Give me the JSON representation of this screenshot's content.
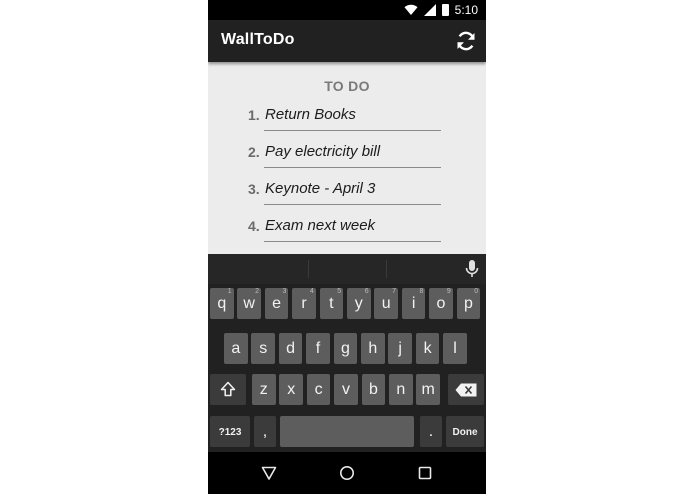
{
  "status_bar": {
    "time": "5:10",
    "icons": [
      "wifi-icon",
      "signal-icon",
      "battery-icon"
    ]
  },
  "app_bar": {
    "title": "WallToDo",
    "action_icon": "refresh-icon"
  },
  "todo": {
    "heading": "TO DO",
    "items": [
      {
        "number": "1.",
        "text": "Return Books"
      },
      {
        "number": "2.",
        "text": "Pay electricity bill"
      },
      {
        "number": "3.",
        "text": "Keynote - April 3"
      },
      {
        "number": "4.",
        "text": "Exam next week"
      }
    ]
  },
  "keyboard": {
    "mic_icon": "microphone-icon",
    "row1": [
      {
        "label": "q",
        "hint": "1"
      },
      {
        "label": "w",
        "hint": "2"
      },
      {
        "label": "e",
        "hint": "3"
      },
      {
        "label": "r",
        "hint": "4"
      },
      {
        "label": "t",
        "hint": "5"
      },
      {
        "label": "y",
        "hint": "6"
      },
      {
        "label": "u",
        "hint": "7"
      },
      {
        "label": "i",
        "hint": "8"
      },
      {
        "label": "o",
        "hint": "9"
      },
      {
        "label": "p",
        "hint": "0"
      }
    ],
    "row2": [
      "a",
      "s",
      "d",
      "f",
      "g",
      "h",
      "j",
      "k",
      "l"
    ],
    "row3": [
      "z",
      "x",
      "c",
      "v",
      "b",
      "n",
      "m"
    ],
    "shift_icon": "shift-icon",
    "backspace_icon": "backspace-icon",
    "symbols_label": "?123",
    "comma_label": ",",
    "period_label": ".",
    "done_label": "Done"
  },
  "nav_bar": {
    "back_icon": "back-triangle-icon",
    "home_icon": "home-circle-icon",
    "recents_icon": "recents-square-icon"
  },
  "colors": {
    "app_bar": "#212121",
    "content_bg": "#ececec",
    "keyboard_bg": "#212121",
    "key": "#5d5d5d",
    "key_dark": "#3b3b3b"
  }
}
